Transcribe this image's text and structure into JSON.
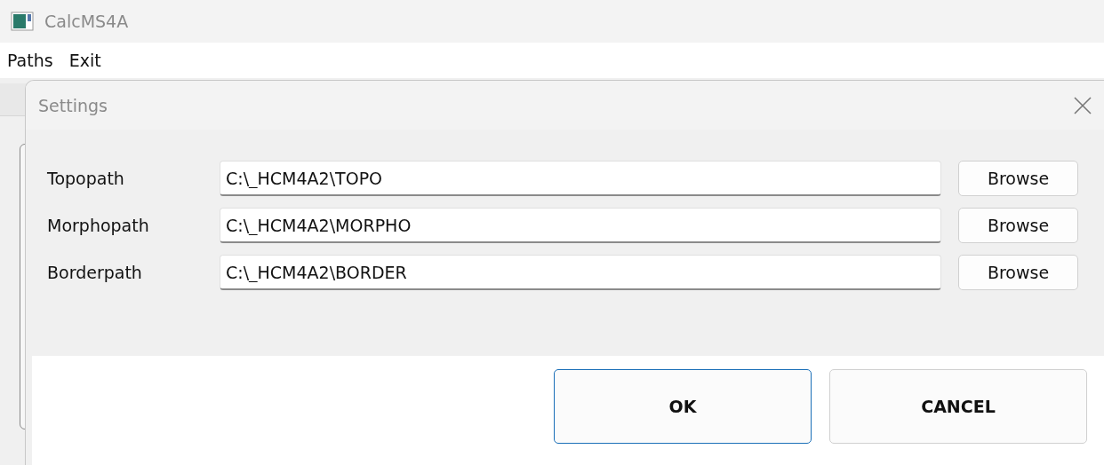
{
  "window": {
    "title": "CalcMS4A"
  },
  "menu": [
    "Paths",
    "Exit"
  ],
  "dialog": {
    "title": "Settings",
    "rows": [
      {
        "label": "Topopath",
        "value": "C:\\_HCM4A2\\TOPO",
        "button": "Browse"
      },
      {
        "label": "Morphopath",
        "value": "C:\\_HCM4A2\\MORPHO",
        "button": "Browse"
      },
      {
        "label": "Borderpath",
        "value": "C:\\_HCM4A2\\BORDER",
        "button": "Browse"
      }
    ],
    "buttons": [
      {
        "label": "OK",
        "kind": "default"
      },
      {
        "label": "CANCEL",
        "kind": "normal"
      }
    ]
  }
}
